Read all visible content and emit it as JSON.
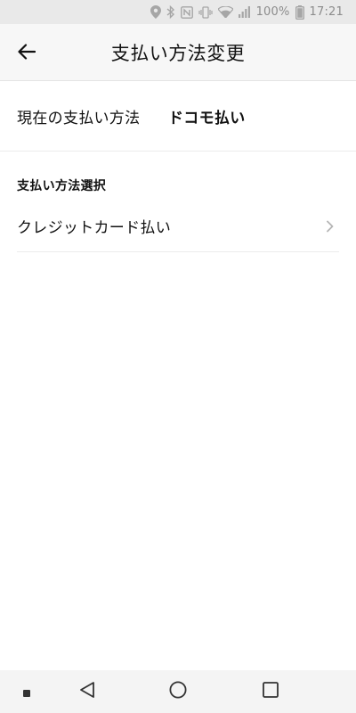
{
  "status_bar": {
    "battery_percent": "100%",
    "time": "17:21",
    "icons": [
      "location-icon",
      "bluetooth-icon",
      "nfc-icon",
      "vibrate-icon",
      "wifi-icon",
      "signal-icon",
      "battery-icon"
    ]
  },
  "header": {
    "title": "支払い方法変更",
    "back_icon": "arrow-left-icon"
  },
  "current": {
    "label": "現在の支払い方法",
    "value": "ドコモ払い"
  },
  "selection": {
    "heading": "支払い方法選択",
    "options": [
      {
        "label": "クレジットカード払い",
        "icon": "chevron-right-icon"
      }
    ]
  },
  "nav": {
    "buttons": [
      "menu-dot-icon",
      "back-triangle-icon",
      "home-circle-icon",
      "recents-square-icon"
    ]
  },
  "colors": {
    "status_bar_bg": "#e9e9e9",
    "header_bg": "#f7f7f7",
    "divider": "#ececec",
    "chevron": "#b5b5b5"
  }
}
